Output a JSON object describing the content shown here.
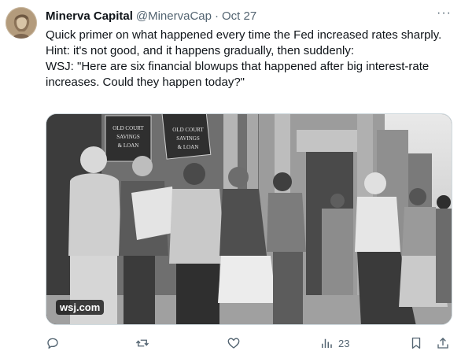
{
  "tweet": {
    "author_name": "Minerva Capital",
    "author_handle": "@MinervaCap",
    "separator": "·",
    "date": "Oct 27",
    "more_label": "···",
    "lines": [
      "Quick primer on what happened every time the Fed increased rates sharply.",
      "Hint: it's not good, and it happens gradually, then suddenly:",
      "WSJ: \"Here are six financial blowups that happened after big interest-rate increases. Could they happen today?\""
    ],
    "media": {
      "source_badge": "wsj.com",
      "signs": {
        "left": [
          "OLD COURT",
          "SAVINGS",
          "& LOAN"
        ],
        "right": [
          "OLD COURT",
          "SAVINGS",
          "& LOAN"
        ]
      }
    }
  },
  "actions": {
    "reply_icon": "reply-icon",
    "retweet_icon": "retweet-icon",
    "like_icon": "heart-icon",
    "views_icon": "views-icon",
    "views_count": "23",
    "bookmark_icon": "bookmark-icon",
    "share_icon": "share-icon"
  }
}
